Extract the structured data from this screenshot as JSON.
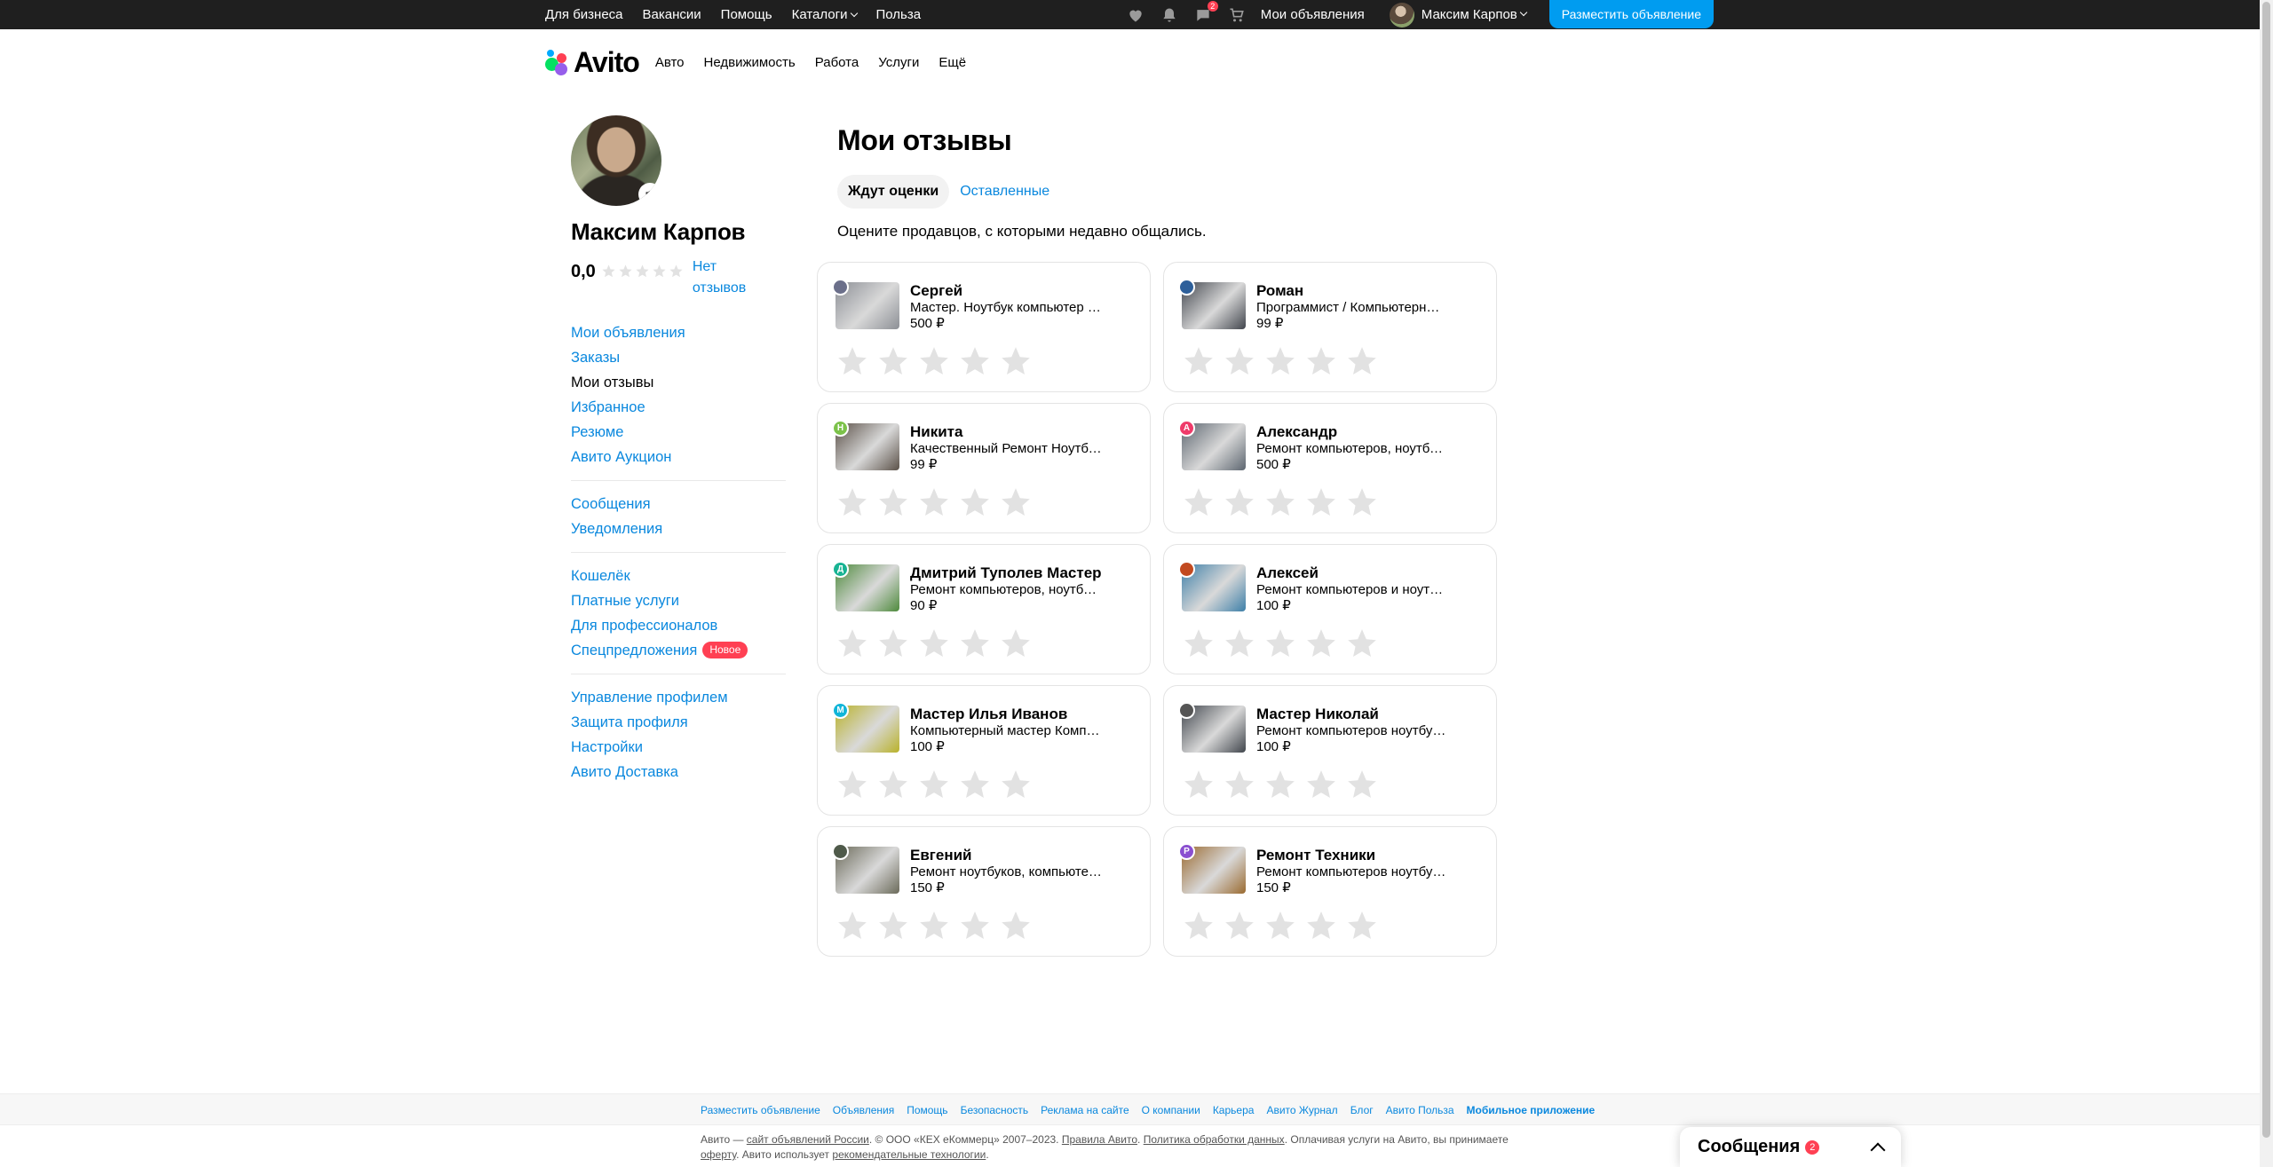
{
  "topbar": {
    "links": [
      "Для бизнеса",
      "Вакансии",
      "Помощь",
      "Каталоги",
      "Польза"
    ],
    "notifications_badge": "2",
    "my_ads": "Мои объявления",
    "user_name": "Максим Карпов",
    "post_button": "Разместить объявление"
  },
  "header": {
    "logo": "Avito",
    "nav": [
      "Авто",
      "Недвижимость",
      "Работа",
      "Услуги",
      "Ещё"
    ]
  },
  "profile": {
    "name": "Максим Карпов",
    "rating": "0,0",
    "no_reviews": "Нет отзывов"
  },
  "menu": {
    "group1": [
      "Мои объявления",
      "Заказы",
      "Мои отзывы",
      "Избранное",
      "Резюме",
      "Авито Аукцион"
    ],
    "group2": [
      "Сообщения",
      "Уведомления"
    ],
    "group3": [
      "Кошелёк",
      "Платные услуги",
      "Для профессионалов",
      "Спецпредложения"
    ],
    "badge_new": "Новое",
    "group4": [
      "Управление профилем",
      "Защита профиля",
      "Настройки",
      "Авито Доставка"
    ]
  },
  "main": {
    "title": "Мои отзывы",
    "tabs": [
      "Ждут оценки",
      "Оставленные"
    ],
    "subtitle": "Оцените продавцов, с которыми недавно общались.",
    "cards": [
      {
        "name": "Сергей",
        "desc": "Мастер. Ноутбук компьютер ремонт",
        "price": "500 ₽",
        "initial": "",
        "avatar_color": "#6b6f8a",
        "thumb": "#8c8f95"
      },
      {
        "name": "Роман",
        "desc": "Программист / Компьютерный мастер",
        "price": "99 ₽",
        "initial": "",
        "avatar_color": "#2d5f9a",
        "thumb": "#41454d"
      },
      {
        "name": "Никита",
        "desc": "Качественный Ремонт Ноутбуков",
        "price": "99 ₽",
        "initial": "Н",
        "avatar_color": "#7cc24a",
        "thumb": "#5b5148"
      },
      {
        "name": "Александр",
        "desc": "Ремонт компьютеров, ноутбуков",
        "price": "500 ₽",
        "initial": "А",
        "avatar_color": "#ef3b6a",
        "thumb": "#5d6670"
      },
      {
        "name": "Дмитрий Туполев Мастер",
        "desc": "Ремонт компьютеров, ноутбуков",
        "price": "90 ₽",
        "initial": "Д",
        "avatar_color": "#18b393",
        "thumb": "#4e8a3c"
      },
      {
        "name": "Алексей",
        "desc": "Ремонт компьютеров и ноутбуков",
        "price": "100 ₽",
        "initial": "",
        "avatar_color": "#c24a20",
        "thumb": "#3d7fa8"
      },
      {
        "name": "Мастер Илья Иванов",
        "desc": "Компьютерный мастер Компьютерщик",
        "price": "100 ₽",
        "initial": "М",
        "avatar_color": "#10b5d8",
        "thumb": "#b9b22a"
      },
      {
        "name": "Мастер Николай",
        "desc": "Ремонт компьютеров ноутбуков",
        "price": "100 ₽",
        "initial": "",
        "avatar_color": "#555555",
        "thumb": "#40454c"
      },
      {
        "name": "Евгений",
        "desc": "Ремонт ноутбуков, компьютеров",
        "price": "150 ₽",
        "initial": "",
        "avatar_color": "#4f5a4a",
        "thumb": "#6b6a5a"
      },
      {
        "name": "Ремонт Техники",
        "desc": "Ремонт компьютеров ноутбуков",
        "price": "150 ₽",
        "initial": "Р",
        "avatar_color": "#8a4fd0",
        "thumb": "#9a6a30"
      }
    ]
  },
  "footer": {
    "links": [
      "Разместить объявление",
      "Объявления",
      "Помощь",
      "Безопасность",
      "Реклама на сайте",
      "О компании",
      "Карьера",
      "Авито Журнал",
      "Блог",
      "Авито Польза",
      "Мобильное приложение"
    ],
    "legal_1": "Авито — ",
    "legal_link1": "сайт объявлений России",
    "legal_2": ". © ООО «КЕХ еКоммерц» 2007–2023. ",
    "legal_link2": "Правила Авито",
    "legal_3": ". ",
    "legal_link3": "Политика обработки данных",
    "legal_4": ". Оплачивая услуги на Авито, вы принимаете ",
    "legal_link4": "оферту",
    "legal_5": ". Авито использует ",
    "legal_link5": "рекомендательные технологии",
    "legal_6": "."
  },
  "messages_widget": {
    "label": "Сообщения",
    "count": "2"
  },
  "colors": {
    "accent": "#0a88de",
    "post_button": "#009cf0",
    "badge": "#ff4053",
    "topbar": "#1f1f1f"
  }
}
